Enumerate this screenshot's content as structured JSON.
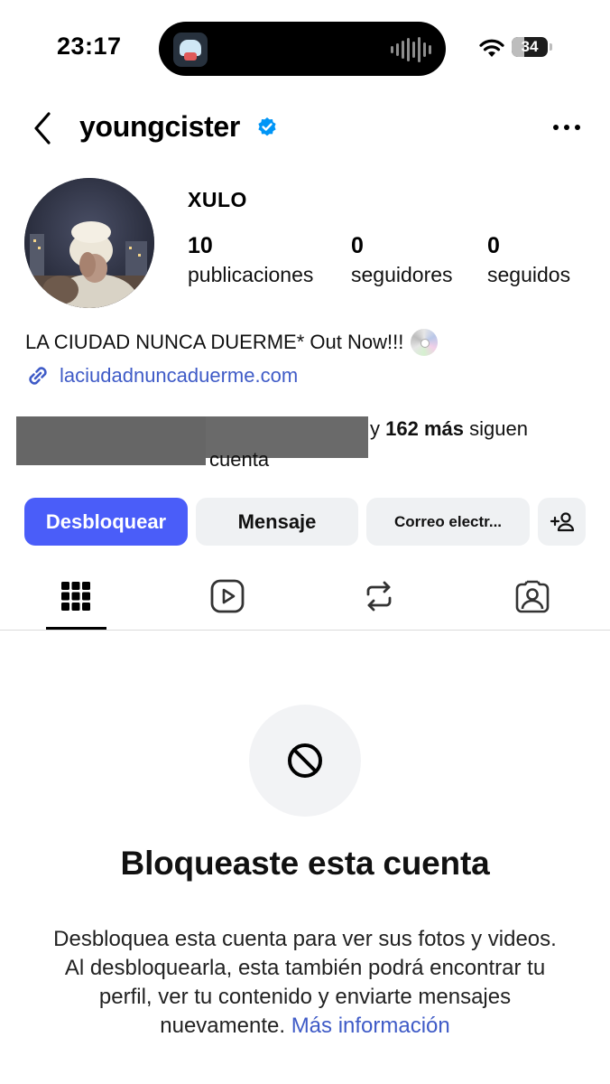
{
  "status_bar": {
    "time": "23:17",
    "battery": "34",
    "icons": [
      "app-icon",
      "audio-wave-icon",
      "wifi-icon",
      "battery-icon"
    ]
  },
  "header": {
    "username": "youngcister",
    "icons": [
      "back-arrow-icon",
      "verified-badge-icon",
      "more-icon"
    ]
  },
  "profile": {
    "display_name": "XULO",
    "stats": [
      {
        "value": "10",
        "label": "publicaciones"
      },
      {
        "value": "0",
        "label": "seguidores"
      },
      {
        "value": "0",
        "label": "seguidos"
      }
    ],
    "bio": "LA CIUDAD NUNCA DUERME* Out Now!!!",
    "link": "laciudadnuncaduerme.com",
    "followed_by": {
      "prefix": "y",
      "count": "162 más",
      "suffix": "siguen",
      "tail": "cuenta"
    }
  },
  "buttons": {
    "unblock": "Desbloquear",
    "message": "Mensaje",
    "email": "Correo electr...",
    "add_user_icon": "add-person-icon"
  },
  "tabs": [
    {
      "name": "grid",
      "icon": "grid-icon",
      "active": true
    },
    {
      "name": "reels",
      "icon": "reels-icon",
      "active": false
    },
    {
      "name": "reposts",
      "icon": "repost-icon",
      "active": false
    },
    {
      "name": "tagged",
      "icon": "tagged-icon",
      "active": false
    }
  ],
  "blocked": {
    "icon": "blocked-icon",
    "title": "Bloqueaste esta cuenta",
    "description": "Desbloquea esta cuenta para ver sus fotos y videos. Al desbloquearla, esta también podrá encontrar tu perfil, ver tu contenido y enviarte mensajes nuevamente.",
    "more_info": "Más información"
  },
  "colors": {
    "primary_button": "#4a5df9",
    "link": "#3f5bc7",
    "secondary_button": "#eff1f3",
    "verified": "#0095f6"
  }
}
